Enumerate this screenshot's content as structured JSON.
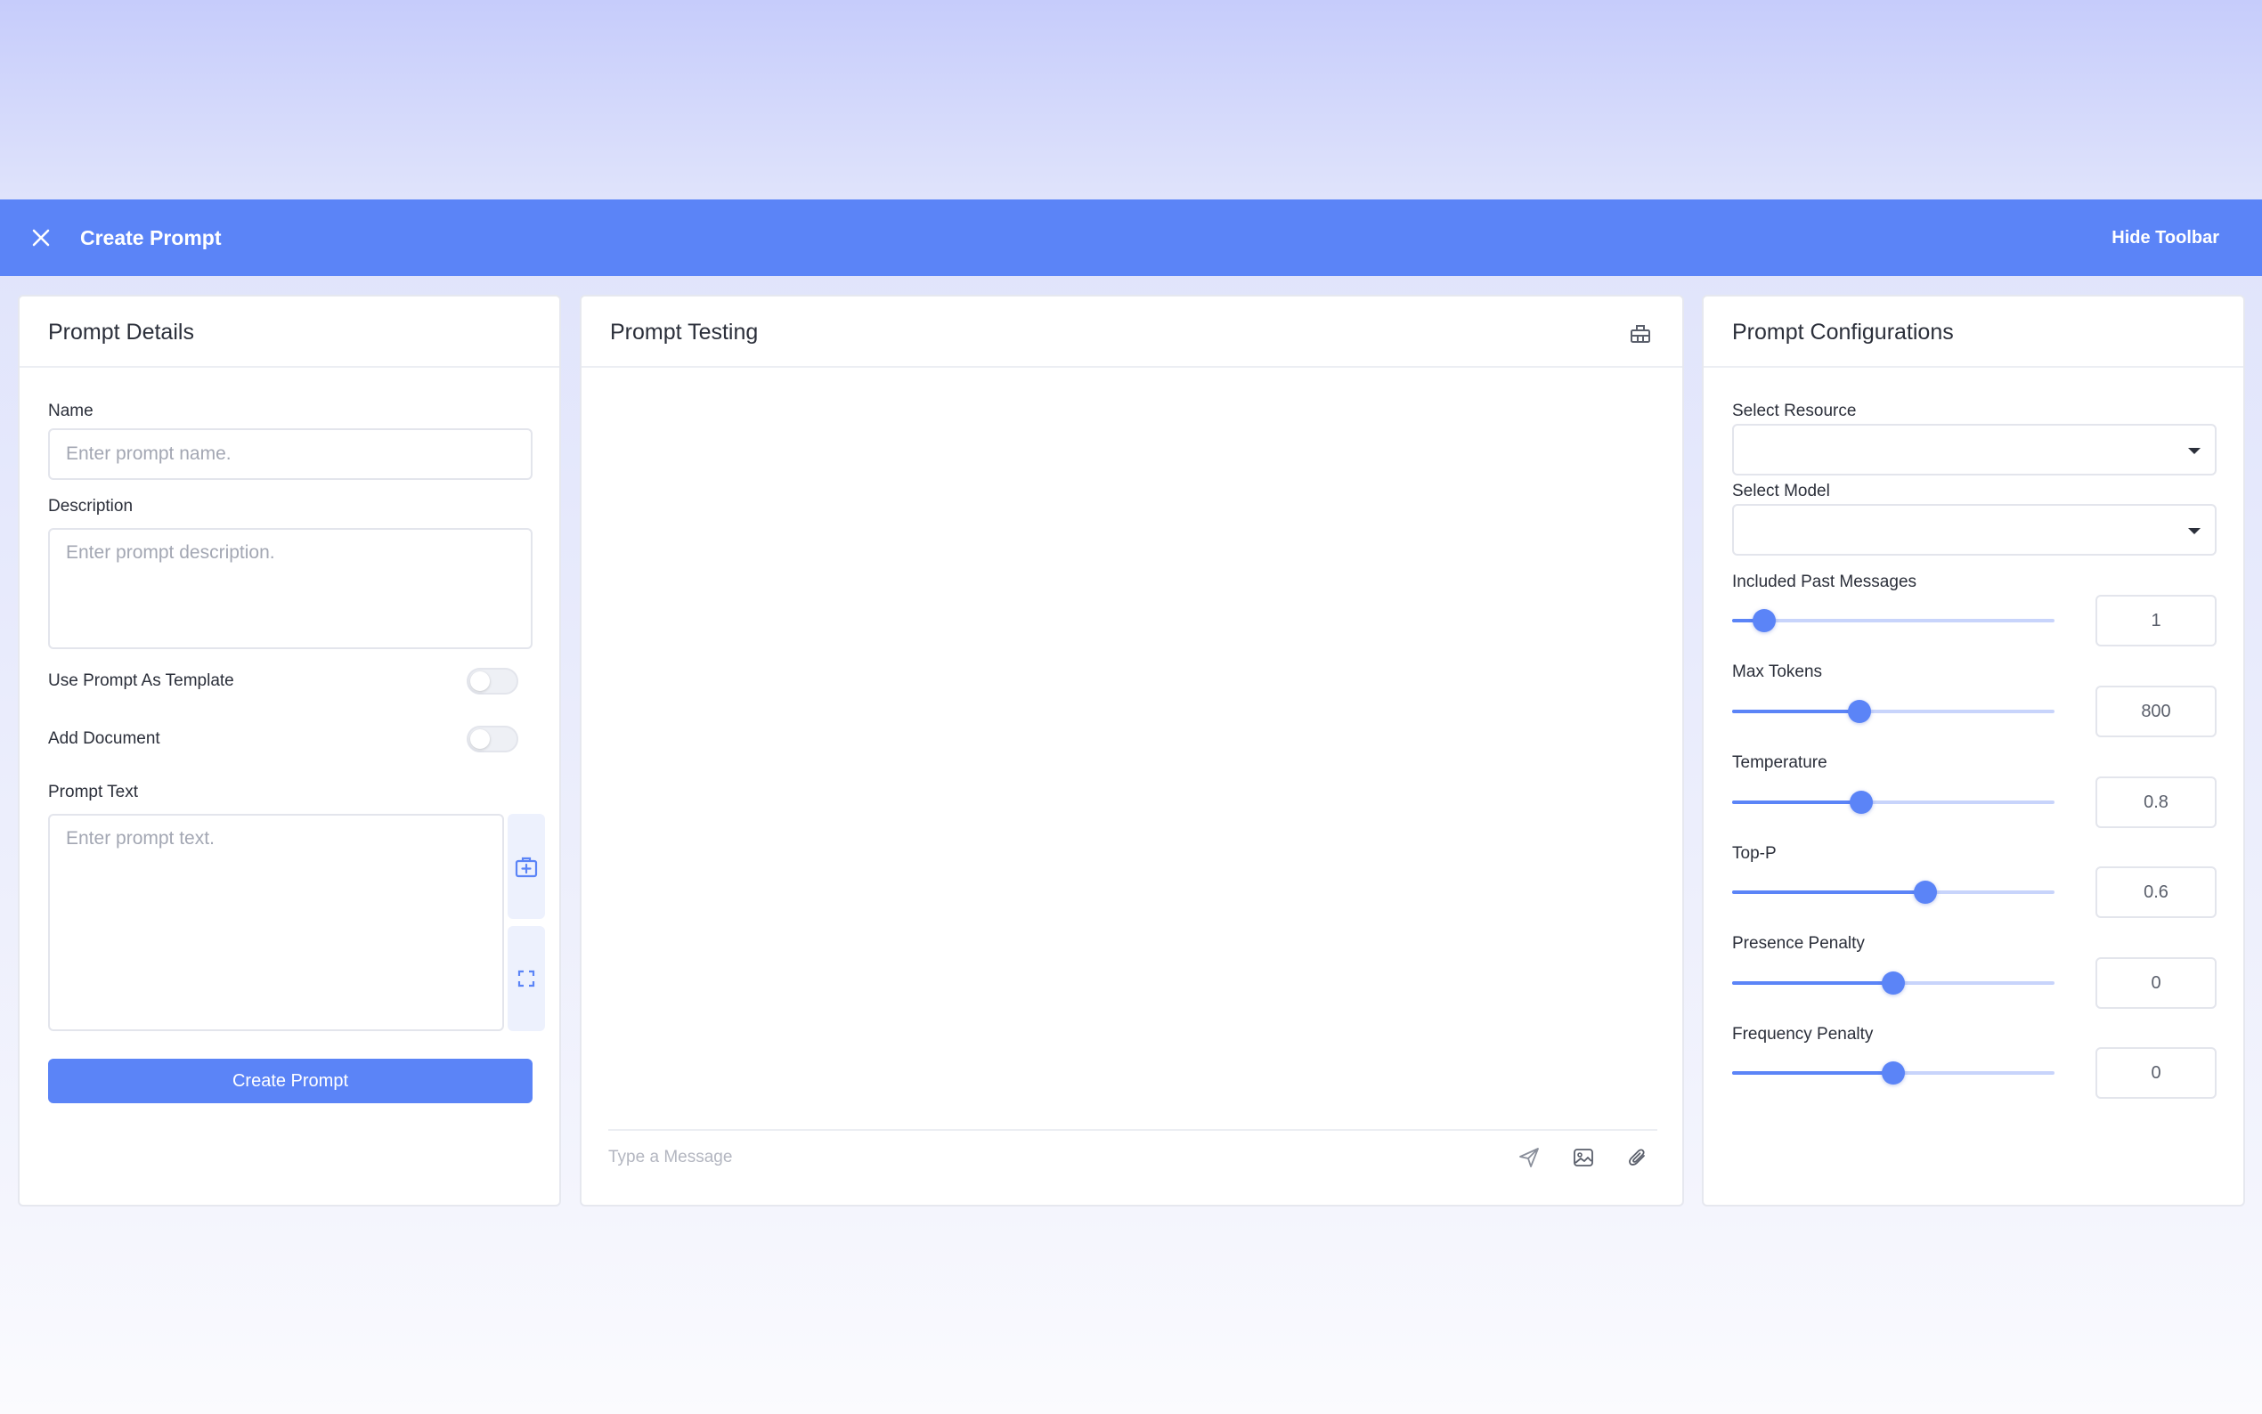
{
  "topbar": {
    "title": "Create Prompt",
    "hide_toolbar_label": "Hide Toolbar",
    "accent_color": "#5b84f7"
  },
  "prompt_details": {
    "title": "Prompt Details",
    "name_label": "Name",
    "name_placeholder": "Enter prompt name.",
    "description_label": "Description",
    "description_placeholder": "Enter prompt description.",
    "use_template_label": "Use Prompt As Template",
    "use_template_on": false,
    "add_document_label": "Add Document",
    "add_document_on": false,
    "prompt_text_label": "Prompt Text",
    "prompt_text_placeholder": "Enter prompt text.",
    "create_button_label": "Create Prompt",
    "side_icons": [
      "add-variable-icon",
      "expand-icon"
    ]
  },
  "prompt_testing": {
    "title": "Prompt Testing",
    "header_icon": "clear-chat-icon",
    "message_placeholder": "Type a Message",
    "message_icons": [
      "send-icon",
      "image-icon",
      "attachment-icon"
    ]
  },
  "prompt_configurations": {
    "title": "Prompt Configurations",
    "resource_label": "Select Resource",
    "resource_value": "",
    "model_label": "Select Model",
    "model_value": "",
    "sliders": [
      {
        "label": "Included Past Messages",
        "value": "1",
        "fraction": 0.1
      },
      {
        "label": "Max Tokens",
        "value": "800",
        "fraction": 0.395
      },
      {
        "label": "Temperature",
        "value": "0.8",
        "fraction": 0.4
      },
      {
        "label": "Top-P",
        "value": "0.6",
        "fraction": 0.6
      },
      {
        "label": "Presence Penalty",
        "value": "0",
        "fraction": 0.5
      },
      {
        "label": "Frequency Penalty",
        "value": "0",
        "fraction": 0.5
      }
    ]
  }
}
